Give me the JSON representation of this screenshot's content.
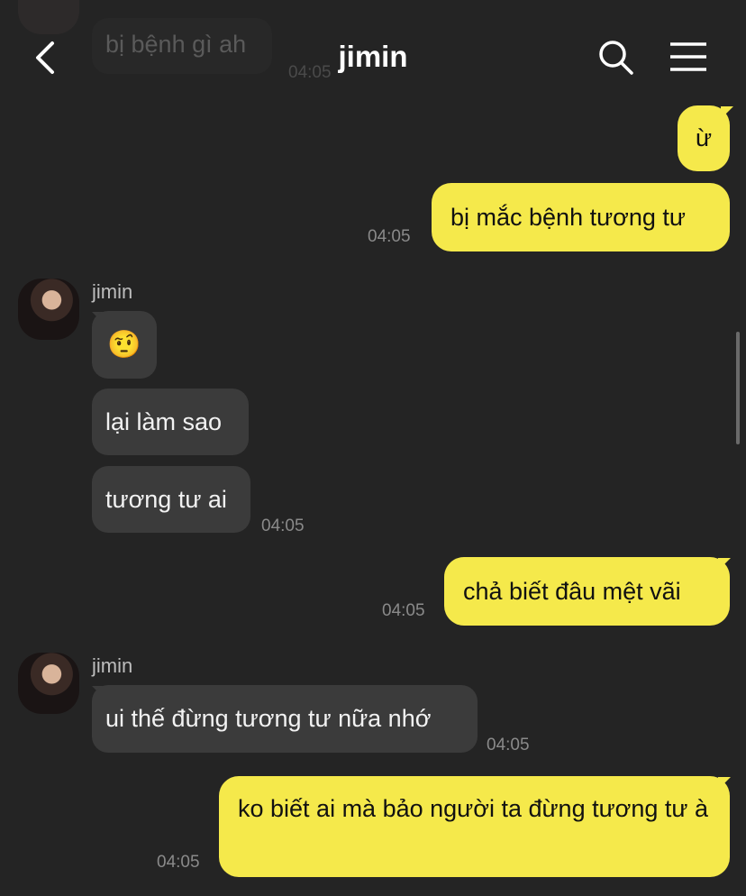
{
  "header": {
    "title": "jimin",
    "ghost_message": "bị bệnh gì ah",
    "ghost_time": "04:05"
  },
  "messages": {
    "m1": "ừ",
    "m2": "bị mắc bệnh tương tư",
    "t2": "04:05",
    "s1": "jimin",
    "m3": "🤨",
    "m4": "lại làm sao",
    "m5": "tương tư ai",
    "t5": "04:05",
    "m6": "chả biết đâu mệt vãi",
    "t6": "04:05",
    "s2": "jimin",
    "m7": "ui thế đừng tương tư nữa nhớ",
    "t7": "04:05",
    "m8": "ko biết ai mà bảo người ta đừng tương tư à",
    "t8": "04:05"
  },
  "colors": {
    "background": "#242424",
    "outgoing_bubble": "#f5e94b",
    "incoming_bubble": "#3b3b3b"
  },
  "icons": [
    "back-arrow-icon",
    "search-icon",
    "menu-icon"
  ]
}
